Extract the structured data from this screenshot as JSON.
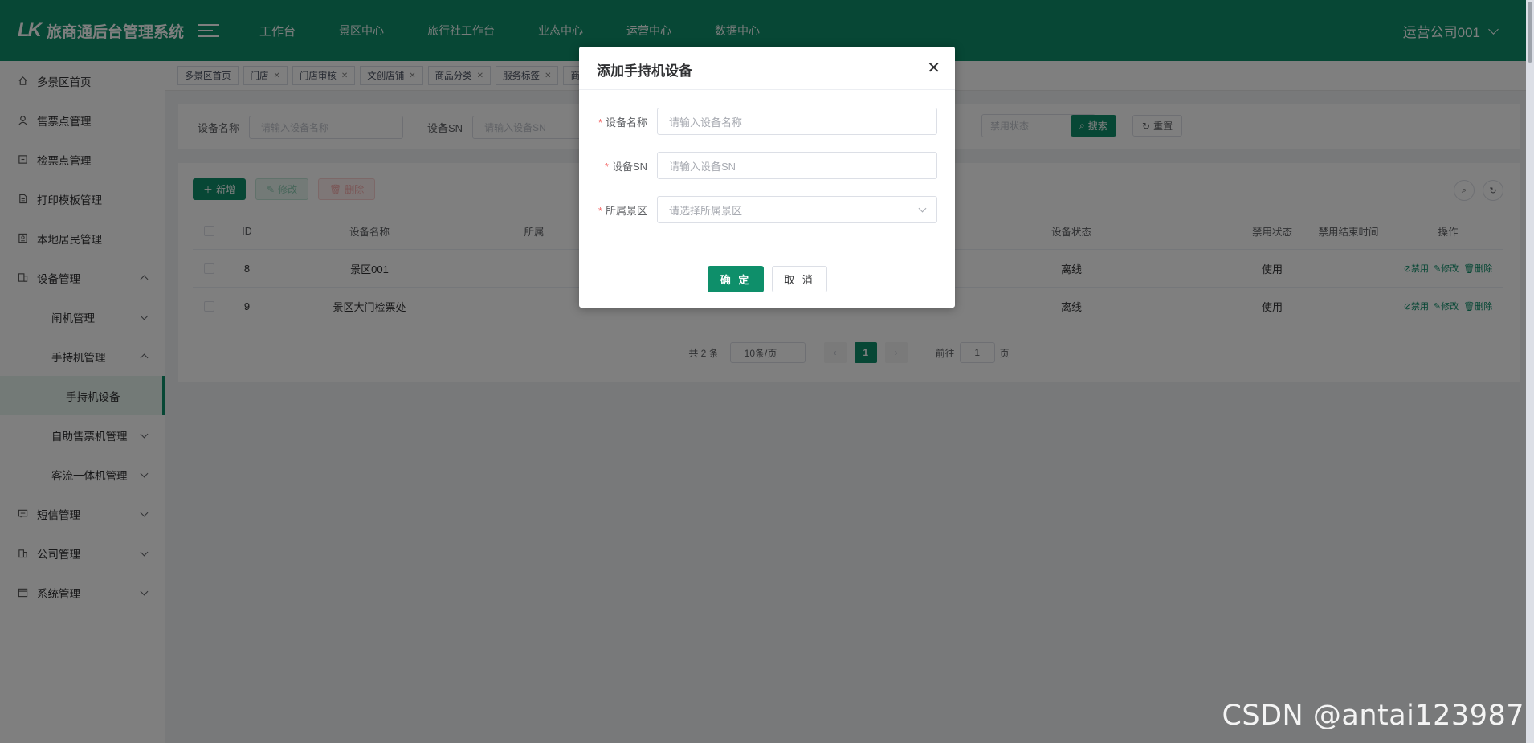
{
  "header": {
    "logo_mark": "LK",
    "title": "旅商通后台管理系统",
    "nav": [
      "工作台",
      "景区中心",
      "旅行社工作台",
      "业态中心",
      "运营中心",
      "数据中心"
    ],
    "user": "运营公司001"
  },
  "sidebar": {
    "items": [
      {
        "label": "多景区首页",
        "icon": "home-icon"
      },
      {
        "label": "售票点管理",
        "icon": "user-icon"
      },
      {
        "label": "检票点管理",
        "icon": "ticket-icon"
      },
      {
        "label": "打印模板管理",
        "icon": "document-icon"
      },
      {
        "label": "本地居民管理",
        "icon": "id-card-icon"
      },
      {
        "label": "设备管理",
        "icon": "device-icon"
      },
      {
        "label": "闸机管理"
      },
      {
        "label": "手持机管理"
      },
      {
        "label": "手持机设备"
      },
      {
        "label": "自助售票机管理"
      },
      {
        "label": "客流一体机管理"
      },
      {
        "label": "短信管理",
        "icon": "message-icon"
      },
      {
        "label": "公司管理",
        "icon": "building-icon"
      },
      {
        "label": "系统管理",
        "icon": "calendar-icon"
      }
    ]
  },
  "tabs": [
    "多景区首页",
    "门店",
    "门店审核",
    "文创店铺",
    "商品分类",
    "服务标签",
    "商"
  ],
  "search": {
    "name_label": "设备名称",
    "name_placeholder": "请输入设备名称",
    "sn_label": "设备SN",
    "sn_placeholder": "请输入设备SN",
    "status_placeholder": "禁用状态",
    "search_btn": "搜索",
    "reset_btn": "重置"
  },
  "toolbar": {
    "add": "新增",
    "edit": "修改",
    "delete": "删除"
  },
  "table": {
    "headers": [
      "ID",
      "设备名称",
      "所属",
      "设备状态",
      "禁用状态",
      "禁用结束时间",
      "操作"
    ],
    "rows": [
      {
        "id": "8",
        "name": "景区001",
        "status": "离线",
        "disable": "使用"
      },
      {
        "id": "9",
        "name": "景区大门检票处",
        "status": "离线",
        "disable": "使用"
      }
    ],
    "actions": [
      "禁用",
      "修改",
      "删除"
    ]
  },
  "pager": {
    "total": "共 2 条",
    "size": "10条/页",
    "current": "1",
    "goto_prefix": "前往",
    "goto_value": "1",
    "goto_suffix": "页"
  },
  "modal": {
    "title": "添加手持机设备",
    "fields": [
      {
        "label": "设备名称",
        "placeholder": "请输入设备名称"
      },
      {
        "label": "设备SN",
        "placeholder": "请输入设备SN"
      },
      {
        "label": "所属景区",
        "placeholder": "请选择所属景区"
      }
    ],
    "ok": "确 定",
    "cancel": "取 消"
  },
  "watermark": "CSDN @antai123987",
  "colors": {
    "brand": "#0e8f6a",
    "danger": "#f56c6c"
  }
}
